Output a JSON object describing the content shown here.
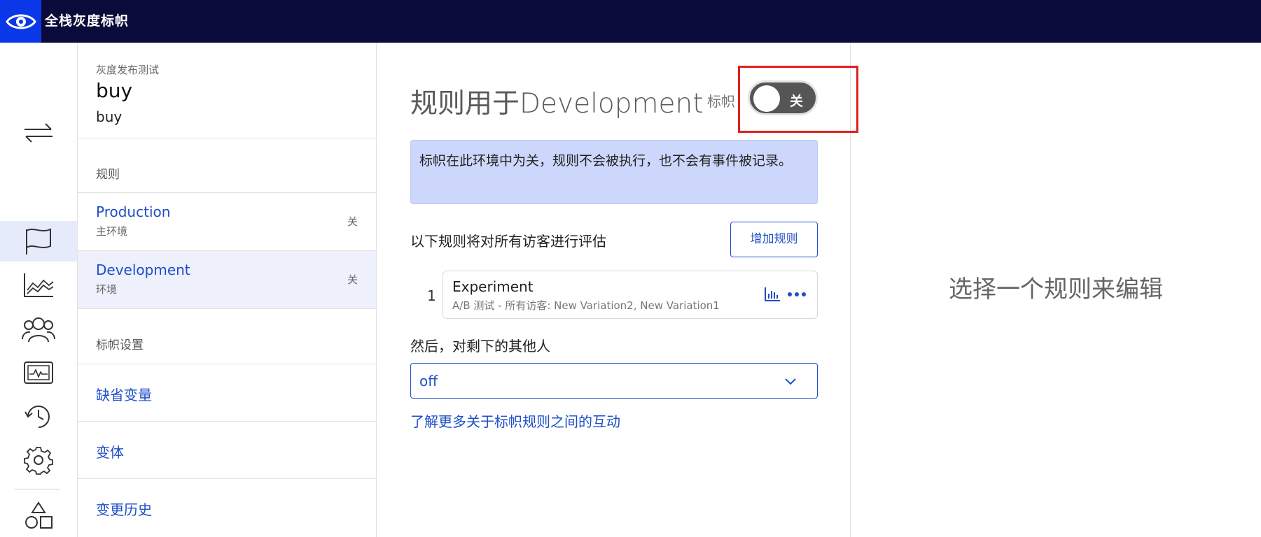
{
  "app": {
    "title": "全栈灰度标帜",
    "logo_icon": "eye-icon",
    "brand_color": "#0a37e8",
    "topbar_color": "#0b0b3b"
  },
  "rail": {
    "items": [
      {
        "icon": "switch-arrows-icon"
      },
      {
        "icon": "flag-icon",
        "active": true
      },
      {
        "icon": "line-chart-icon"
      },
      {
        "icon": "users-icon"
      },
      {
        "icon": "monitor-pulse-icon"
      },
      {
        "icon": "history-icon"
      },
      {
        "icon": "gear-icon"
      },
      {
        "icon": "shapes-icon"
      }
    ]
  },
  "flag": {
    "project": "灰度发布测试",
    "key": "buy",
    "name": "buy"
  },
  "rules_section": {
    "title": "规则",
    "environments": [
      {
        "name": "Production",
        "desc": "主环境",
        "status": "关"
      },
      {
        "name": "Development",
        "desc": "环境",
        "status": "关",
        "selected": true
      }
    ]
  },
  "settings_section": {
    "title": "标帜设置",
    "links": [
      "缺省变量",
      "变体",
      "变更历史"
    ]
  },
  "main": {
    "title": "规则用于Development",
    "flag_label": "标帜",
    "toggle_label": "关",
    "notice": "标帜在此环境中为关，规则不会被执行，也不会有事件被记录。",
    "eval_text": "以下规则将对所有访客进行评估",
    "add_rule_label": "增加规则",
    "rules": [
      {
        "index": "1",
        "name": "Experiment",
        "desc": "A/B 测试 - 所有访客: New Variation2, New Variation1"
      }
    ],
    "then_text": "然后，对剩下的其他人",
    "fallback_value": "off",
    "learn_more": "了解更多关于标帜规则之间的互动"
  },
  "right_panel": {
    "placeholder": "选择一个规则来编辑"
  }
}
